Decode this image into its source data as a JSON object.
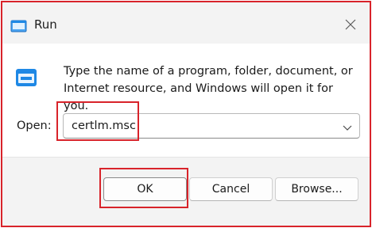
{
  "window": {
    "title": "Run",
    "app_icon": "run-app-icon",
    "close_icon": "close-icon"
  },
  "content": {
    "icon": "run-icon",
    "description": "Type the name of a program, folder, document, or Internet resource, and Windows will open it for you.",
    "open_label": "Open:",
    "open_value": "certlm.msc",
    "dropdown_icon": "chevron-down-icon"
  },
  "buttons": {
    "ok": "OK",
    "cancel": "Cancel",
    "browse": "Browse..."
  },
  "colors": {
    "highlight": "#d8232a",
    "icon_blue": "#1e88e5"
  }
}
